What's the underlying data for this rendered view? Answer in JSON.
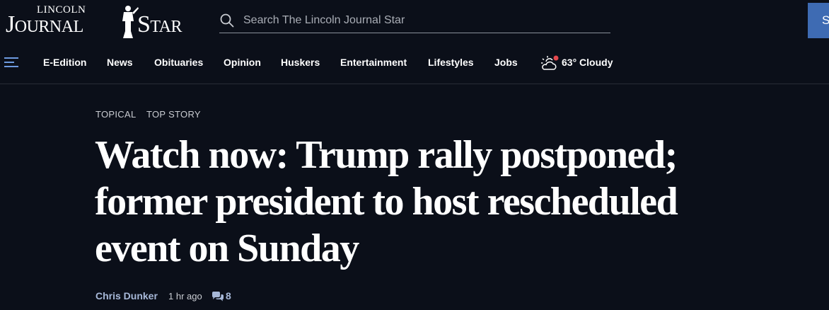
{
  "brand": {
    "logo_small": "LINCOLN",
    "logo_left": "Journal",
    "logo_right": "Star"
  },
  "search": {
    "placeholder": "Search The Lincoln Journal Star"
  },
  "header": {
    "subscribe_label": "S"
  },
  "nav": {
    "items": [
      {
        "label": "E-Edition"
      },
      {
        "label": "News"
      },
      {
        "label": "Obituaries"
      },
      {
        "label": "Opinion"
      },
      {
        "label": "Huskers"
      },
      {
        "label": "Entertainment"
      },
      {
        "label": "Lifestyles"
      },
      {
        "label": "Jobs"
      }
    ],
    "weather": {
      "text": "63° Cloudy",
      "icon": "partly-cloudy-icon"
    }
  },
  "article": {
    "tags": [
      "TOPICAL",
      "TOP STORY"
    ],
    "headline_lines": [
      "Watch now: Trump rally postponed;",
      "former president to host rescheduled",
      "event on Sunday"
    ],
    "author": "Chris Dunker",
    "time": "1 hr ago",
    "comment_count": "8"
  },
  "colors": {
    "background": "#0b0f19",
    "subscribe_button": "#3e6bb3",
    "author_link": "#a7b8d8",
    "weather_alert_dot": "#e5484d"
  }
}
